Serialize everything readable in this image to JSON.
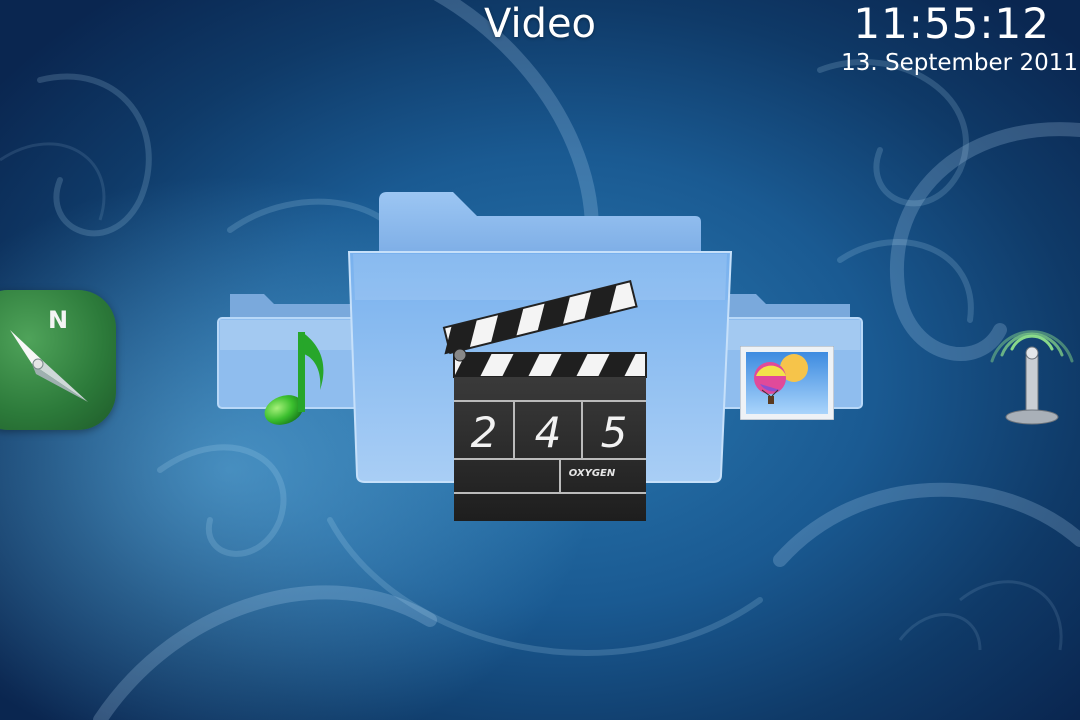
{
  "header": {
    "title": "Video"
  },
  "clock": {
    "time": "11:55:12",
    "date": "13. September 2011"
  },
  "menu": {
    "items": [
      {
        "name": "navigation",
        "icon": "compass-icon"
      },
      {
        "name": "music",
        "icon": "music-note-icon"
      },
      {
        "name": "video",
        "icon": "clapperboard-icon",
        "selected": true
      },
      {
        "name": "pictures",
        "icon": "picture-icon"
      },
      {
        "name": "network",
        "icon": "antenna-icon"
      }
    ]
  },
  "clapperboard": {
    "digits": [
      "2",
      "4",
      "5"
    ],
    "brand": "OXYGEN"
  },
  "compass": {
    "letter": "N"
  },
  "colors": {
    "background_dark": "#0f3a68",
    "folder_blue": "#7fb2ea",
    "compass_green": "#2c7a3a"
  }
}
